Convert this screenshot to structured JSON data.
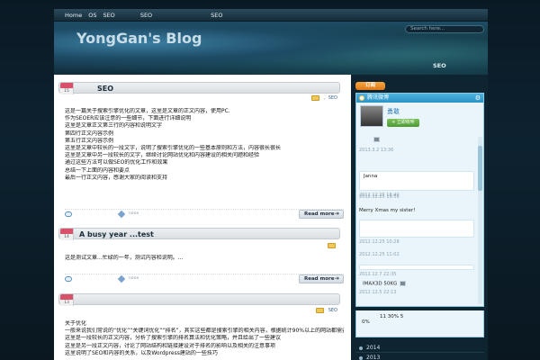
{
  "nav": {
    "items": [
      "Home",
      "OS",
      "SEO",
      "SEO",
      "SEO"
    ]
  },
  "header": {
    "title": "YongGan's Blog",
    "search_placeholder": "Search here...",
    "seo_label": "SEO"
  },
  "posts": [
    {
      "date": "15",
      "title": "SEO",
      "category": "SEO",
      "category_prefix": ",",
      "body": [
        "这是一篇关于搜索引擎优化的文章，这里是文章的正文内容，使用PC.",
        "作为SEOER应该注意的一些细节，下面进行详细说明",
        "这里是文章正文第三行的内容和说明文字",
        "第四行正文内容示例",
        "第五行正文内容示例",
        "这里是文章中较长的一段文字，说明了搜索引擎优化的一些基本原则和方法，内容很长很长",
        "这里是文章中另一段较长的文字，继续讨论网站优化和内容建设的相关问题和经验",
        "通过这些方法可以做SEO的优化工作和效果",
        "总结一下上面的内容和要点",
        "最后一行正文内容，感谢大家的阅读和支持"
      ],
      "tags": "none",
      "read_more": "Read more"
    },
    {
      "date": "14",
      "title": "A busy year ...test",
      "body": [
        "这是测试文章...忙碌的一年，测试内容和说明。..."
      ],
      "tags": "none",
      "read_more": "Read more"
    },
    {
      "date": "13",
      "category": "SEO",
      "body": [
        "关于优化",
        "一般来说我们常说的“优化”“关键词优化”“排名”，其实这些都是搜索引擎的相关内容，根据统计90%以上的网站都需要",
        "这里是一段较长的正文内容，分析了搜索引擎的排名算法和优化策略，并且给出了一些建议",
        "这里是另一段正文内容，讨论了网站结构和链接建设对于排名的影响以及相关的注意事项",
        "这里说明了SEO和内容的关系，以及Wordpress建站的一些技巧"
      ]
    }
  ],
  "sidebar": {
    "rss_label": "订阅",
    "weibo": {
      "title": "腾讯微博",
      "name": "勇敢",
      "follow_label": "+ 立即收听",
      "feed": [
        {
          "text": "",
          "time": "2013.3.2  13:36"
        },
        {
          "text": "Janna",
          "time": "2012.12.25  18:40"
        },
        {
          "text": "",
          "time": "2012.12.25  19:56"
        },
        {
          "text": "Merry Xmas my sister!",
          "time": "2012.12.25  10:28"
        },
        {
          "text": "",
          "time": "2012.12.25  11:02"
        },
        {
          "text": "",
          "time": "2012.12.7  22:35"
        },
        {
          "text": "IMAX3D      50KG",
          "time": "2012.12.5  22:13"
        },
        {
          "text": "11          30%  5",
          "time": ""
        },
        {
          "text": "0%",
          "time": ""
        }
      ]
    },
    "archives": [
      "2014",
      "2013"
    ]
  }
}
